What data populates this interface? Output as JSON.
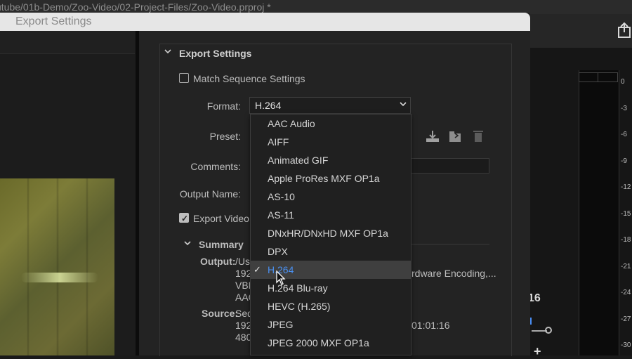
{
  "path_bar": {
    "text": "utube/01b-Demo/Zoo-Video/02-Project-Files/Zoo-Video.prproj *"
  },
  "dialog": {
    "title": "Export Settings",
    "section_title": "Export Settings",
    "match_sequence_label": "Match Sequence Settings",
    "match_sequence_checked": false,
    "format_label": "Format:",
    "format_value": "H.264",
    "preset_label": "Preset:",
    "comments_label": "Comments:",
    "output_name_label": "Output Name:",
    "export_video_label": "Export Video",
    "export_video_checked": true,
    "summary_title": "Summary",
    "summary": {
      "output_label": "Output:",
      "output_lines": [
        "/Us",
        "192",
        "VBF",
        "AAC"
      ],
      "output_right": "rdware Encoding,...",
      "source_label": "Source:",
      "source_lines": [
        "Seq",
        "192",
        "480"
      ],
      "source_right": "01:01:16"
    }
  },
  "format_dropdown": {
    "options": [
      {
        "label": "AAC Audio"
      },
      {
        "label": "AIFF"
      },
      {
        "label": "Animated GIF"
      },
      {
        "label": "Apple ProRes MXF OP1a"
      },
      {
        "label": "AS-10"
      },
      {
        "label": "AS-11"
      },
      {
        "label": "DNxHR/DNxHD MXF OP1a"
      },
      {
        "label": "DPX"
      },
      {
        "label": "H.264",
        "selected": true
      },
      {
        "label": "H.264 Blu-ray"
      },
      {
        "label": "HEVC (H.265)"
      },
      {
        "label": "JPEG"
      },
      {
        "label": "JPEG 2000 MXF OP1a"
      }
    ],
    "selected_color": "#4a90f0",
    "check_glyph": "✓"
  },
  "premiere": {
    "time_fragment": "16",
    "meter_ticks": [
      "0",
      "-3",
      "-6",
      "-9",
      "-12",
      "-15",
      "-18",
      "-21",
      "-24",
      "-27",
      "-30"
    ],
    "plus_glyph": "+"
  },
  "icons": {
    "share": "share-icon",
    "save_preset": "save-preset-icon",
    "import_preset": "import-preset-icon",
    "delete_preset": "trash-icon",
    "chevron": "chevron-down-icon",
    "cursor": "mouse-pointer-icon"
  }
}
